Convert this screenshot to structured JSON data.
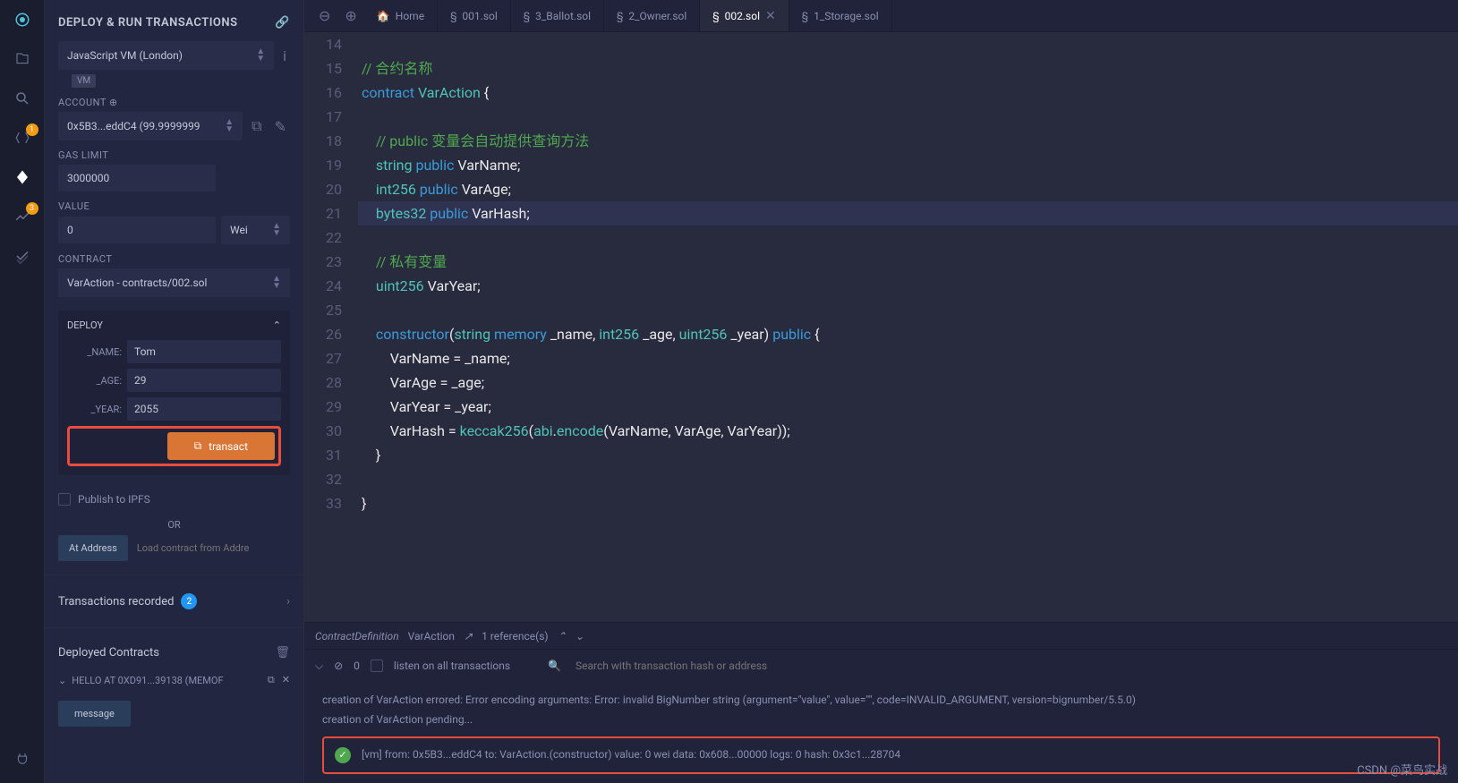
{
  "panel_title": "DEPLOY & RUN TRANSACTIONS",
  "env": {
    "label": "JavaScript VM (London)",
    "badge": "VM"
  },
  "account": {
    "label": "ACCOUNT",
    "value": "0x5B3...eddC4 (99.9999999"
  },
  "gas": {
    "label": "GAS LIMIT",
    "value": "3000000"
  },
  "value": {
    "label": "VALUE",
    "amount": "0",
    "unit": "Wei"
  },
  "contract": {
    "label": "CONTRACT",
    "value": "VarAction - contracts/002.sol"
  },
  "deploy": {
    "title": "DEPLOY",
    "params": [
      {
        "label": "_NAME:",
        "value": "Tom"
      },
      {
        "label": "_AGE:",
        "value": "29"
      },
      {
        "label": "_YEAR:",
        "value": "2055"
      }
    ],
    "button": "transact"
  },
  "publish_ipfs": "Publish to IPFS",
  "or": "OR",
  "at_address": {
    "btn": "At Address",
    "placeholder": "Load contract from Addre"
  },
  "trans_recorded": {
    "label": "Transactions recorded",
    "count": "2"
  },
  "deployed": {
    "title": "Deployed Contracts",
    "item": "HELLO AT 0XD91...39138 (MEMOF"
  },
  "message_btn": "message",
  "iconbar_badges": {
    "arrows": "1",
    "chart": "3"
  },
  "tabs": [
    {
      "label": "Home",
      "icon": "home"
    },
    {
      "label": "001.sol",
      "icon": "sol"
    },
    {
      "label": "3_Ballot.sol",
      "icon": "sol"
    },
    {
      "label": "2_Owner.sol",
      "icon": "sol"
    },
    {
      "label": "002.sol",
      "icon": "sol",
      "active": true
    },
    {
      "label": "1_Storage.sol",
      "icon": "sol"
    }
  ],
  "code": {
    "start": 14,
    "lines": [
      {
        "n": 14,
        "html": ""
      },
      {
        "n": 15,
        "html": "<span class='cm'>// 合约名称</span>"
      },
      {
        "n": 16,
        "html": "<span class='kw'>contract</span> <span class='ty'>VarAction</span> <span class='pn'>{</span>"
      },
      {
        "n": 17,
        "html": ""
      },
      {
        "n": 18,
        "html": "    <span class='cm'>// public 变量会自动提供查询方法</span>"
      },
      {
        "n": 19,
        "html": "    <span class='ty'>string</span> <span class='kw'>public</span> <span class='id'>VarName</span><span class='pn'>;</span>"
      },
      {
        "n": 20,
        "html": "    <span class='ty'>int256</span> <span class='kw'>public</span> <span class='id'>VarAge</span><span class='pn'>;</span>"
      },
      {
        "n": 21,
        "hl": true,
        "dot": true,
        "html": "    <span class='ty'>bytes32</span> <span class='kw'>public</span> <span class='id'>VarHash</span><span class='pn'>;</span>"
      },
      {
        "n": 22,
        "dot": true,
        "html": ""
      },
      {
        "n": 23,
        "dot": true,
        "html": "    <span class='cm'>// 私有变量</span>"
      },
      {
        "n": 24,
        "html": "    <span class='ty'>uint256</span> <span class='id'>VarYear</span><span class='pn'>;</span>"
      },
      {
        "n": 25,
        "html": ""
      },
      {
        "n": 26,
        "html": "    <span class='kw'>constructor</span><span class='pn'>(</span><span class='ty'>string</span> <span class='kw'>memory</span> <span class='id'>_name</span><span class='pn'>,</span> <span class='ty'>int256</span> <span class='id'>_age</span><span class='pn'>,</span> <span class='ty'>uint256</span> <span class='id'>_year</span><span class='pn'>)</span> <span class='kw'>public</span> <span class='pn'>{</span>"
      },
      {
        "n": 27,
        "html": "        <span class='id'>VarName</span> <span class='pn'>=</span> <span class='id'>_name</span><span class='pn'>;</span>"
      },
      {
        "n": 28,
        "html": "        <span class='id'>VarAge</span> <span class='pn'>=</span> <span class='id'>_age</span><span class='pn'>;</span>"
      },
      {
        "n": 29,
        "html": "        <span class='id'>VarYear</span> <span class='pn'>=</span> <span class='id'>_year</span><span class='pn'>;</span>"
      },
      {
        "n": 30,
        "html": "        <span class='id'>VarHash</span> <span class='pn'>=</span> <span class='fn'>keccak256</span><span class='pn'>(</span><span class='fn'>abi</span><span class='pn'>.</span><span class='fn'>encode</span><span class='pn'>(</span><span class='id'>VarName</span><span class='pn'>,</span> <span class='id'>VarAge</span><span class='pn'>,</span> <span class='id'>VarYear</span><span class='pn'>));</span>"
      },
      {
        "n": 31,
        "html": "    <span class='pn'>}</span>"
      },
      {
        "n": 32,
        "html": ""
      },
      {
        "n": 33,
        "html": "<span class='pn'>}</span>"
      }
    ]
  },
  "breadcrumb": {
    "type": "ContractDefinition",
    "name": "VarAction",
    "refs": "1 reference(s)"
  },
  "terminal": {
    "listen": "listen on all transactions",
    "search_placeholder": "Search with transaction hash or address",
    "zero": "0",
    "lines": [
      "creation of VarAction errored: Error encoding arguments: Error: invalid BigNumber string (argument=\"value\", value=\"\", code=INVALID_ARGUMENT, version=bignumber/5.5.0)",
      "creation of VarAction pending..."
    ],
    "success": "[vm]  from: 0x5B3...eddC4 to: VarAction.(constructor) value: 0 wei data: 0x608...00000 logs: 0 hash: 0x3c1...28704"
  },
  "watermark": "CSDN @菜鸟实战"
}
